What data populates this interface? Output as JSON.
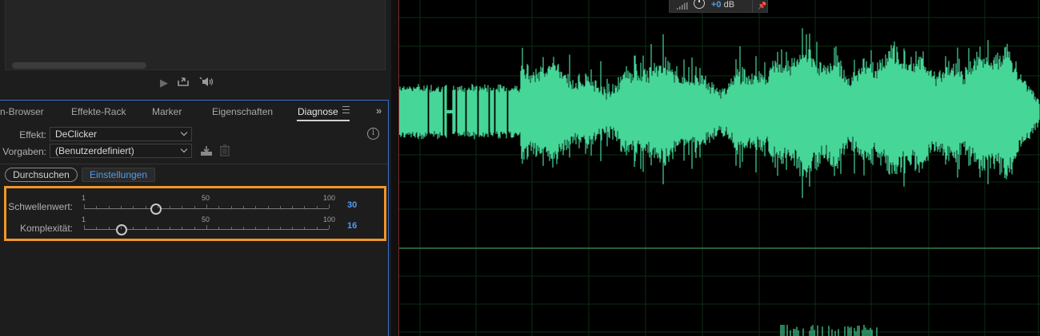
{
  "preview": {
    "transport_icons": [
      "play-icon",
      "loop-icon",
      "speaker-icon"
    ]
  },
  "tabs": [
    {
      "label": "n-Browser"
    },
    {
      "label": "Effekte-Rack"
    },
    {
      "label": "Marker"
    },
    {
      "label": "Eigenschaften"
    },
    {
      "label": "Diagnose"
    }
  ],
  "effect": {
    "label": "Effekt:",
    "value": "DeClicker"
  },
  "presets": {
    "label": "Vorgaben:",
    "value": "(Benutzerdefiniert)"
  },
  "buttons": {
    "scan": "Durchsuchen",
    "settings": "Einstellungen"
  },
  "sliders": [
    {
      "label": "Schwellenwert:",
      "min": "1",
      "mid": "50",
      "max": "100",
      "value": "30",
      "fraction": 0.293
    },
    {
      "label": "Komplexität:",
      "min": "1",
      "mid": "50",
      "max": "100",
      "value": "16",
      "fraction": 0.152
    }
  ],
  "hud": {
    "gain": "+0",
    "unit": "dB"
  },
  "colors": {
    "waveform": "#46d698",
    "accent": "#4f9cf5",
    "highlight": "#f0962a",
    "panel_focus": "#3b6fd1"
  }
}
